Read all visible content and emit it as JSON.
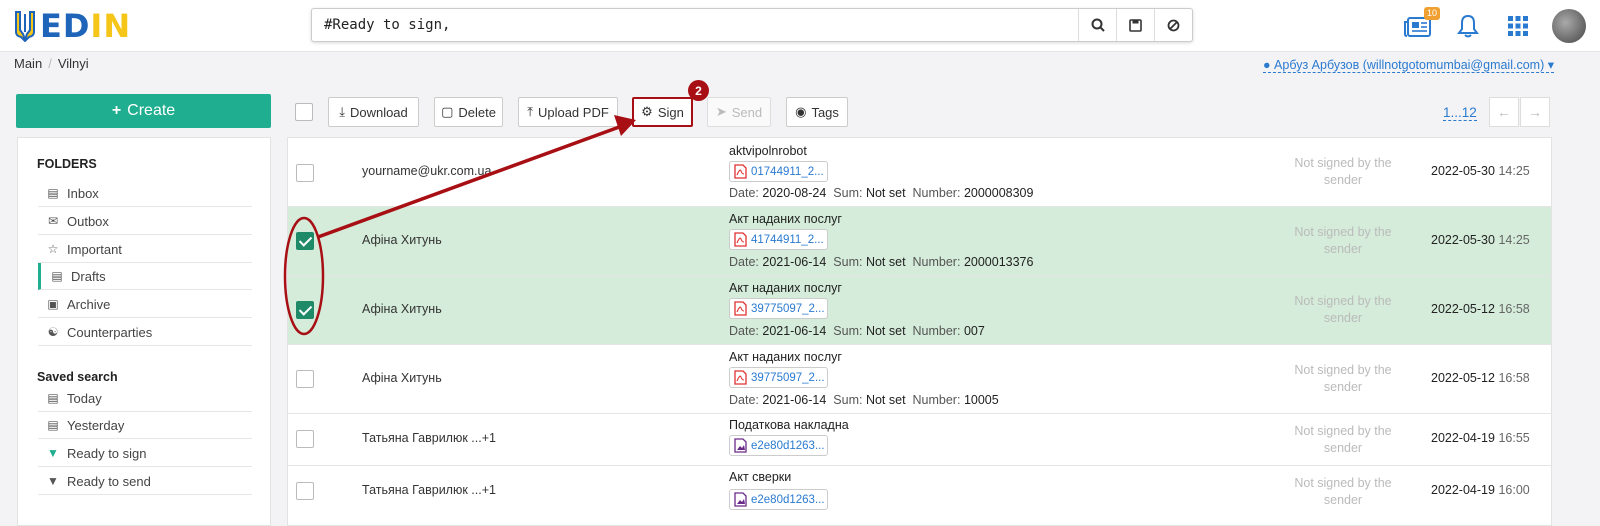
{
  "header": {
    "logo_text_blue": "ED",
    "logo_text_yellow": "IN",
    "search_value": "#Ready to sign,",
    "notifications_badge": "10"
  },
  "breadcrumb": {
    "items": [
      "Main",
      "Vilnyi"
    ]
  },
  "user": {
    "label": "Арбуз Арбузов (willnotgotomumbai@gmail.com)"
  },
  "sidebar": {
    "create_label": "Create",
    "folders_heading": "FOLDERS",
    "folders": [
      "Inbox",
      "Outbox",
      "Important",
      "Drafts",
      "Archive",
      "Counterparties"
    ],
    "saved_heading": "Saved search",
    "saved": [
      "Today",
      "Yesterday",
      "Ready to sign",
      "Ready to send"
    ]
  },
  "toolbar": {
    "download": "Download",
    "delete": "Delete",
    "upload_pdf": "Upload PDF",
    "sign": "Sign",
    "send": "Send",
    "tags": "Tags",
    "pager": "1...12"
  },
  "annotation": {
    "step": "2"
  },
  "labels": {
    "date": "Date:",
    "sum": "Sum:",
    "number": "Number:"
  },
  "rows": [
    {
      "sender": "yourname@ukr.com.ua",
      "title": "aktvipolnrobot",
      "file": "01744911_2...",
      "date": "2020-08-24",
      "sum": "Not set",
      "number": "2000008309",
      "status": "Not signed by the sender",
      "created": "2022-05-30",
      "time": "14:25"
    },
    {
      "sender": "Афіна Хитунь",
      "title": "Акт наданих послуг",
      "file": "41744911_2...",
      "date": "2021-06-14",
      "sum": "Not set",
      "number": "2000013376",
      "status": "Not signed by the sender",
      "created": "2022-05-30",
      "time": "14:25"
    },
    {
      "sender": "Афіна Хитунь",
      "title": "Акт наданих послуг",
      "file": "39775097_2...",
      "date": "2021-06-14",
      "sum": "Not set",
      "number": "007",
      "status": "Not signed by the sender",
      "created": "2022-05-12",
      "time": "16:58"
    },
    {
      "sender": "Афіна Хитунь",
      "title": "Акт наданих послуг",
      "file": "39775097_2...",
      "date": "2021-06-14",
      "sum": "Not set",
      "number": "10005",
      "status": "Not signed by the sender",
      "created": "2022-05-12",
      "time": "16:58"
    },
    {
      "sender": "Татьяна Гаврилюк ...+1",
      "title": "Податкова накладна",
      "file": "e2e80d1263...",
      "status": "Not signed by the sender",
      "created": "2022-04-19",
      "time": "16:55"
    },
    {
      "sender": "Татьяна Гаврилюк ...+1",
      "title": "Акт сверки",
      "file": "e2e80d1263...",
      "status": "Not signed by the sender",
      "created": "2022-04-19",
      "time": "16:00"
    }
  ],
  "colors": {
    "accent": "#1fae8f",
    "link": "#2a7ad0",
    "selected_row": "#d4ecd9",
    "annotation": "#a80f14"
  }
}
